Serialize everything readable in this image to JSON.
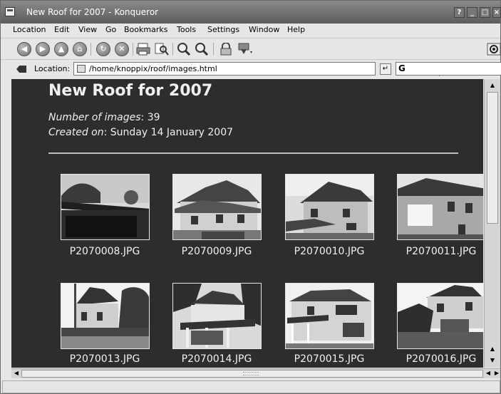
{
  "window": {
    "title": "New Roof for 2007 - Konqueror",
    "buttons": {
      "help": "?",
      "minimize": "_",
      "maximize": "□",
      "close": "×"
    }
  },
  "menu": [
    "Location",
    "Edit",
    "View",
    "Go",
    "Bookmarks",
    "Tools",
    "Settings",
    "Window",
    "Help"
  ],
  "toolbar": {
    "icons": [
      "back-icon",
      "forward-icon",
      "up-icon",
      "home-icon",
      "reload-icon",
      "stop-icon",
      "print-icon",
      "find-icon",
      "zoom-in-icon",
      "zoom-out-icon",
      "lock-icon",
      "download-icon",
      "konqueror-gear-icon"
    ]
  },
  "location": {
    "label": "Location:",
    "url": "/home/knoppix/roof/images.html",
    "search_engine_glyph": "G"
  },
  "page": {
    "title": "New Roof for 2007",
    "count_label": "Number of images",
    "count_value": ": 39",
    "created_label": "Created on",
    "created_value": ": Sunday 14 January 2007"
  },
  "images": [
    {
      "filename": "P2070008.JPG",
      "icon": "garage-roof-photo"
    },
    {
      "filename": "P2070009.JPG",
      "icon": "house-photo"
    },
    {
      "filename": "P2070010.JPG",
      "icon": "house-photo"
    },
    {
      "filename": "P2070011.JPG",
      "icon": "house-side-photo"
    },
    {
      "filename": "P2070013.JPG",
      "icon": "house-street-photo"
    },
    {
      "filename": "P2070014.JPG",
      "icon": "house-porch-photo"
    },
    {
      "filename": "P2070015.JPG",
      "icon": "house-front-photo"
    },
    {
      "filename": "P2070016.JPG",
      "icon": "house-corner-photo"
    }
  ],
  "status": {
    "text": ""
  }
}
